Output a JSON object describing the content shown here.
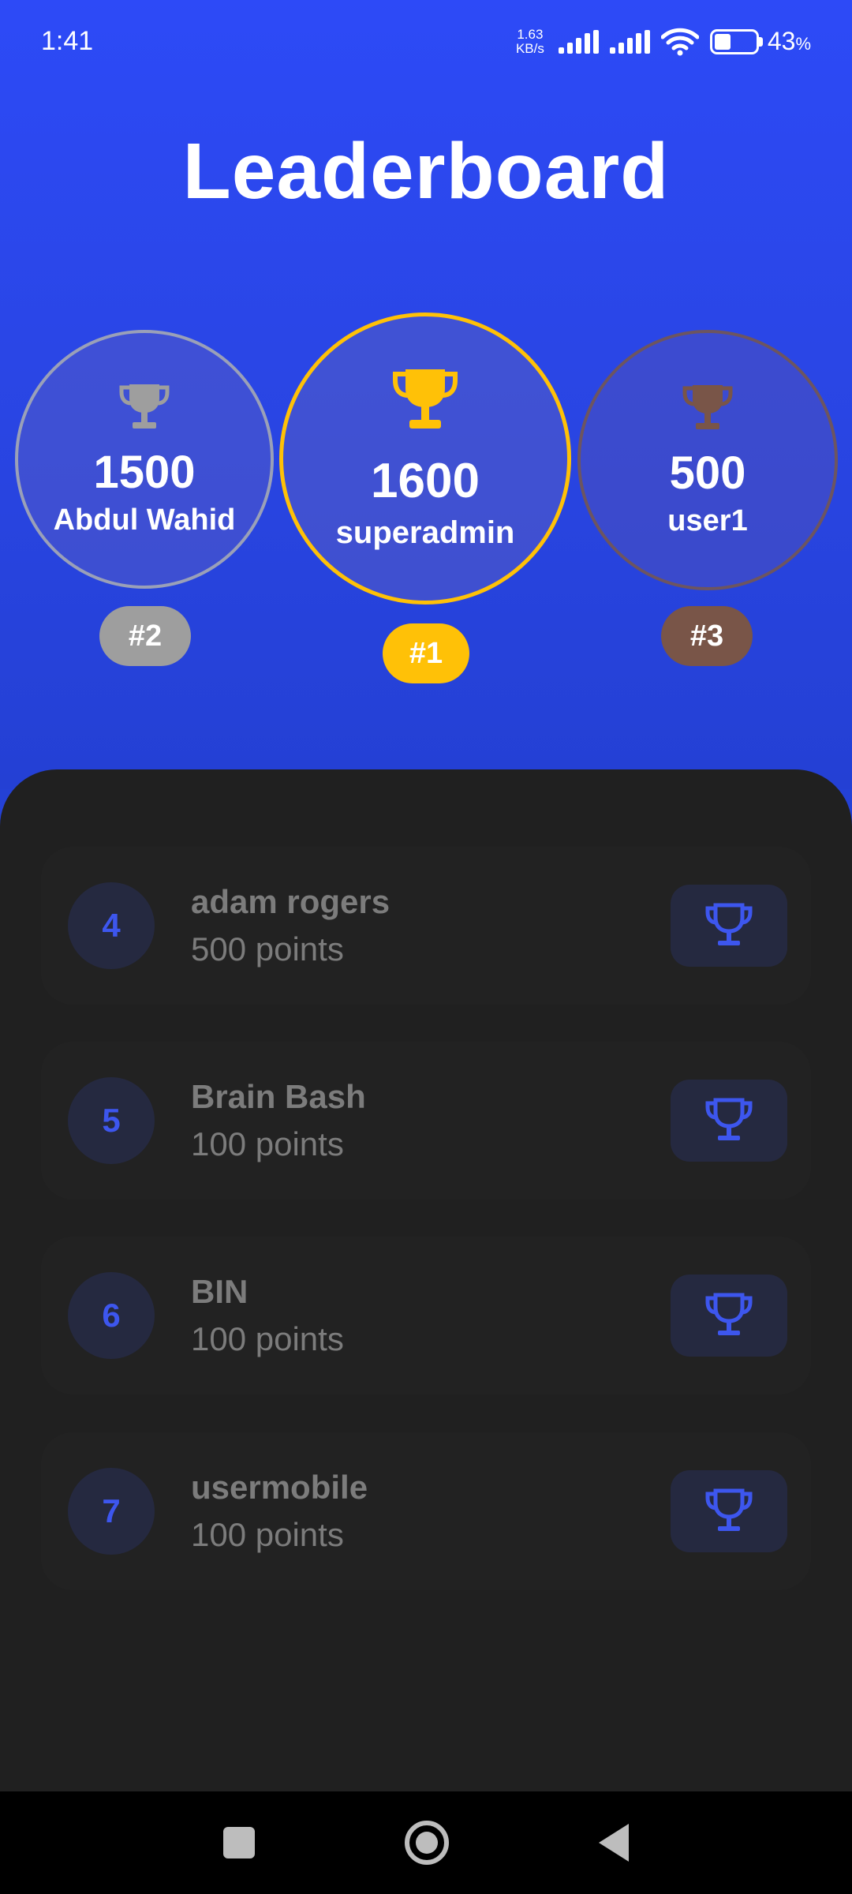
{
  "status_bar": {
    "time": "1:41",
    "net_speed_value": "1.63",
    "net_speed_unit": "KB/s",
    "battery_percent": "43",
    "battery_symbol": "%"
  },
  "header": {
    "title": "Leaderboard"
  },
  "podium": {
    "first": {
      "score": "1600",
      "name": "superadmin",
      "rank": "#1",
      "color": "#ffc107"
    },
    "second": {
      "score": "1500",
      "name": "Abdul Wahid",
      "rank": "#2",
      "color": "#9e9e9e"
    },
    "third": {
      "score": "500",
      "name": "user1",
      "rank": "#3",
      "color": "#795548"
    }
  },
  "list": {
    "rows": [
      {
        "rank": "4",
        "name": "adam rogers",
        "points": "500 points"
      },
      {
        "rank": "5",
        "name": "Brain Bash",
        "points": "100 points"
      },
      {
        "rank": "6",
        "name": "BIN",
        "points": "100 points"
      },
      {
        "rank": "7",
        "name": "usermobile",
        "points": "100 points"
      }
    ],
    "accent_color": "#3d56ee",
    "icon": "trophy-icon"
  },
  "nav": {
    "icons": [
      "recents-icon",
      "home-icon",
      "back-icon"
    ]
  }
}
